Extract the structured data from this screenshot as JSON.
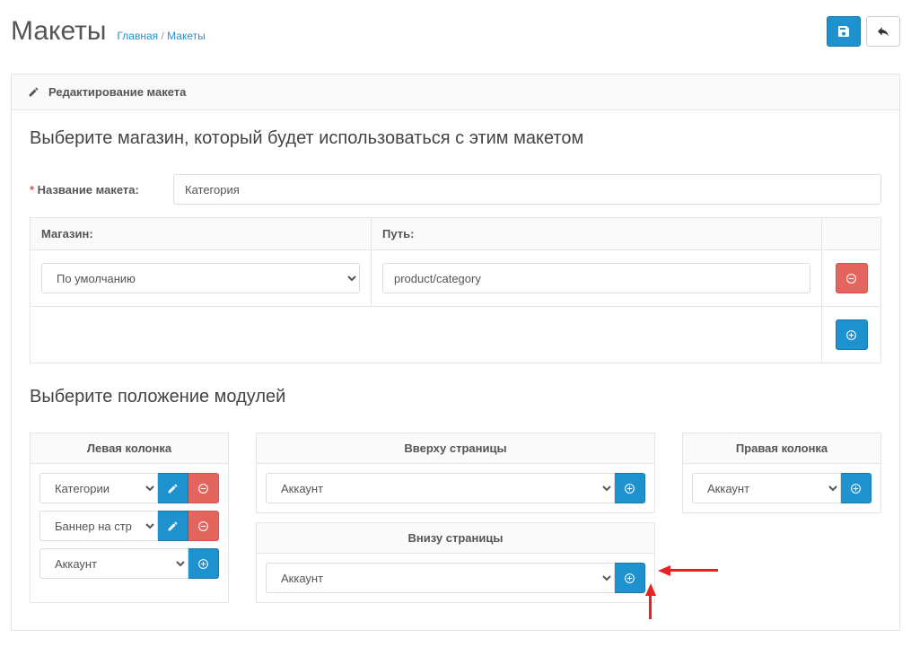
{
  "header": {
    "title": "Макеты",
    "breadcrumb_home": "Главная",
    "breadcrumb_current": "Макеты"
  },
  "panel": {
    "heading": "Редактирование макета"
  },
  "store_section": {
    "title": "Выберите магазин, который будет использоваться с этим макетом",
    "name_label": "Название макета:",
    "name_value": "Категория",
    "store_header": "Магазин:",
    "route_header": "Путь:",
    "store_selected": "По умолчанию",
    "route_value": "product/category"
  },
  "positions_section": {
    "title": "Выберите положение модулей",
    "left": {
      "heading": "Левая колонка",
      "rows": [
        {
          "selected": "Категории",
          "actions": "edit-remove"
        },
        {
          "selected": "Баннер на страниц",
          "actions": "edit-remove"
        },
        {
          "selected": "Аккаунт",
          "actions": "add"
        }
      ]
    },
    "top": {
      "heading": "Вверху страницы",
      "rows": [
        {
          "selected": "Аккаунт",
          "actions": "add"
        }
      ]
    },
    "bottom": {
      "heading": "Внизу страницы",
      "rows": [
        {
          "selected": "Аккаунт",
          "actions": "add"
        }
      ]
    },
    "right": {
      "heading": "Правая колонка",
      "rows": [
        {
          "selected": "Аккаунт",
          "actions": "add"
        }
      ]
    }
  },
  "icons": {
    "save": "save-icon",
    "back": "reply-icon",
    "pencil": "pencil-icon",
    "plus": "plus-icon",
    "minus": "minus-icon"
  }
}
